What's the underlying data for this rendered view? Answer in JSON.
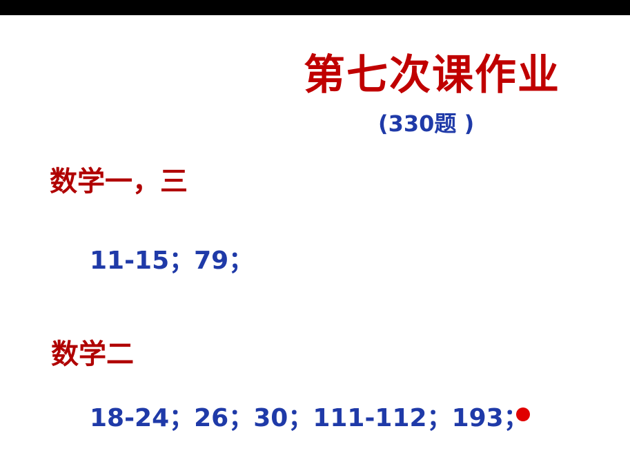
{
  "slide": {
    "title": "第七次课作业",
    "subtitle": "(330题 )",
    "sections": [
      {
        "heading": "数学一，三",
        "problems": "11-15；79；"
      },
      {
        "heading": "数学二",
        "problems": "18-24；26；30；111-112；193；"
      }
    ]
  },
  "colors": {
    "title": "#c00000",
    "heading": "#b00000",
    "problems": "#1f3aa8",
    "pointer": "#e00000",
    "top_bar": "#000000"
  }
}
